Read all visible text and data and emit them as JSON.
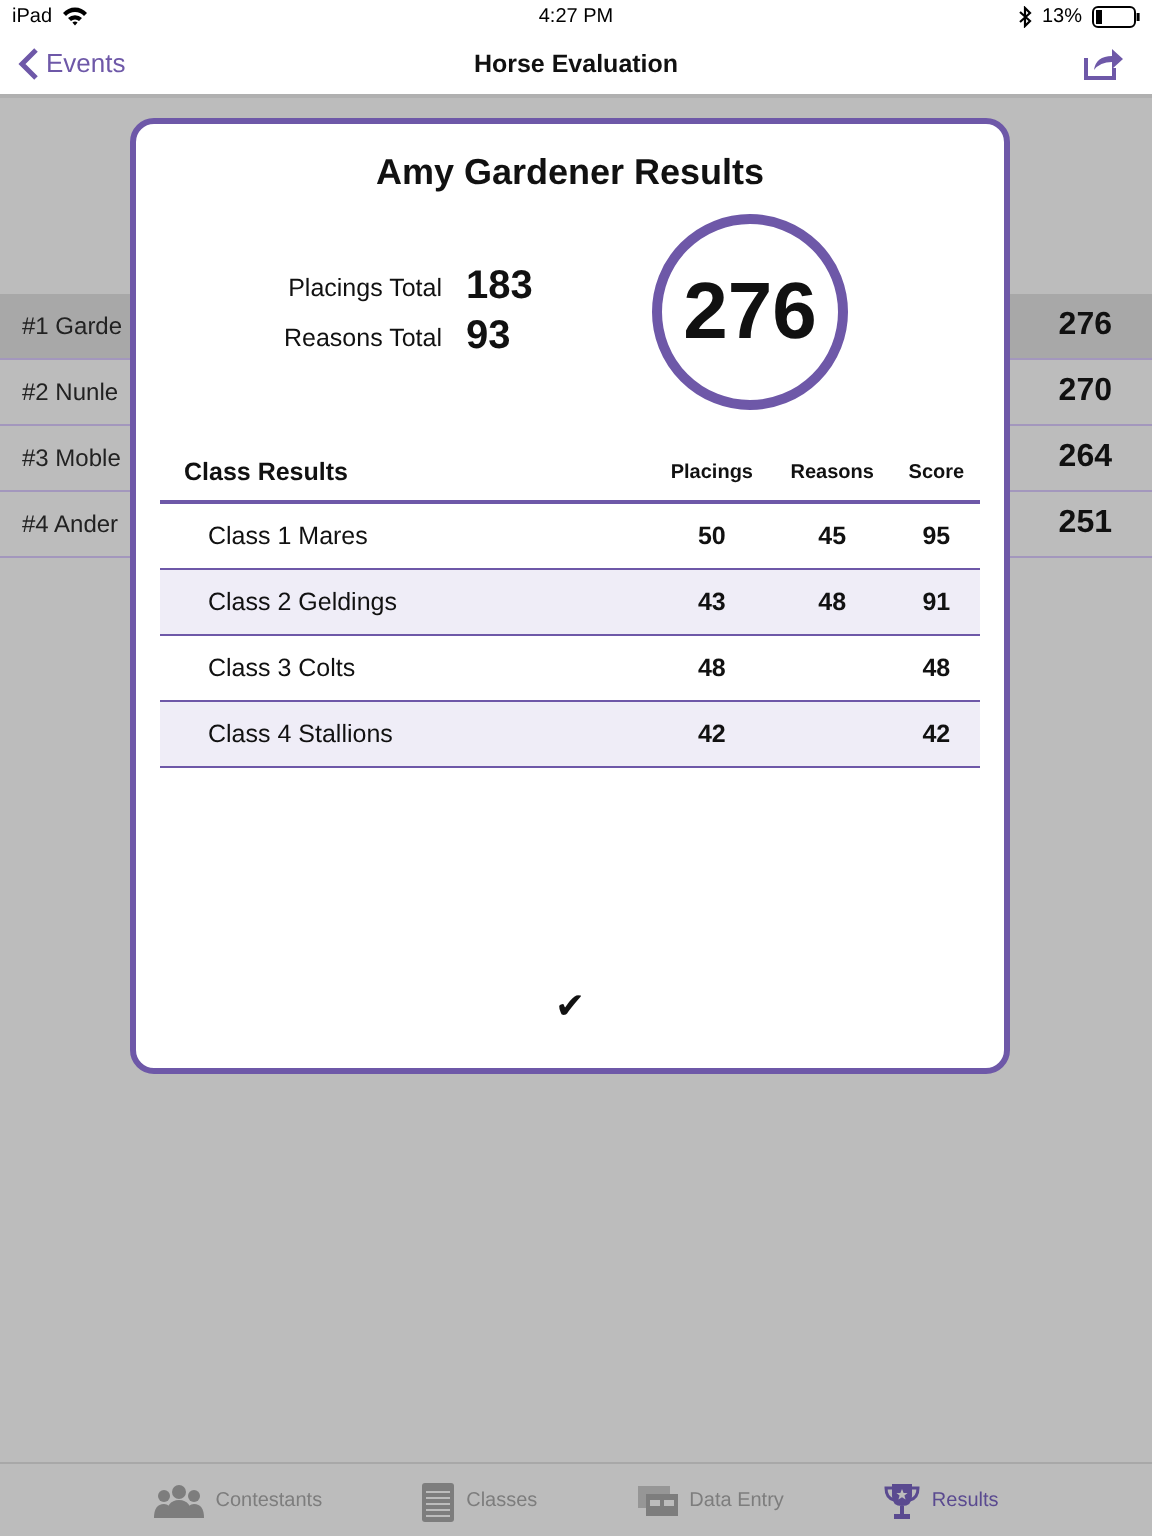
{
  "status_bar": {
    "device": "iPad",
    "time": "4:27 PM",
    "battery": "13%"
  },
  "nav": {
    "back": "Events",
    "title": "Horse Evaluation"
  },
  "background_rows": [
    {
      "label": "#1  Garde",
      "score": "276",
      "selected": true
    },
    {
      "label": "#2  Nunle",
      "score": "270",
      "selected": false
    },
    {
      "label": "#3  Moble",
      "score": "264",
      "selected": false
    },
    {
      "label": "#4  Ander",
      "score": "251",
      "selected": false
    }
  ],
  "dialog": {
    "title": "Amy Gardener Results",
    "totals": [
      {
        "label": "Placings Total",
        "value": "183"
      },
      {
        "label": "Reasons Total",
        "value": "93"
      }
    ],
    "total_score": "276",
    "table": {
      "columns": [
        "Class Results",
        "Placings",
        "Reasons",
        "Score"
      ],
      "rows": [
        [
          "Class 1 Mares",
          "50",
          "45",
          "95"
        ],
        [
          "Class 2 Geldings",
          "43",
          "48",
          "91"
        ],
        [
          "Class 3 Colts",
          "48",
          "",
          "48"
        ],
        [
          "Class 4 Stallions",
          "42",
          "",
          "42"
        ]
      ]
    },
    "confirm": "✔"
  },
  "tabs": [
    {
      "label": "Contestants",
      "kind": "people",
      "selected": false
    },
    {
      "label": "Classes",
      "kind": "notepad",
      "selected": false
    },
    {
      "label": "Data Entry",
      "kind": "cards",
      "selected": false
    },
    {
      "label": "Results",
      "kind": "trophy",
      "selected": true
    }
  ]
}
